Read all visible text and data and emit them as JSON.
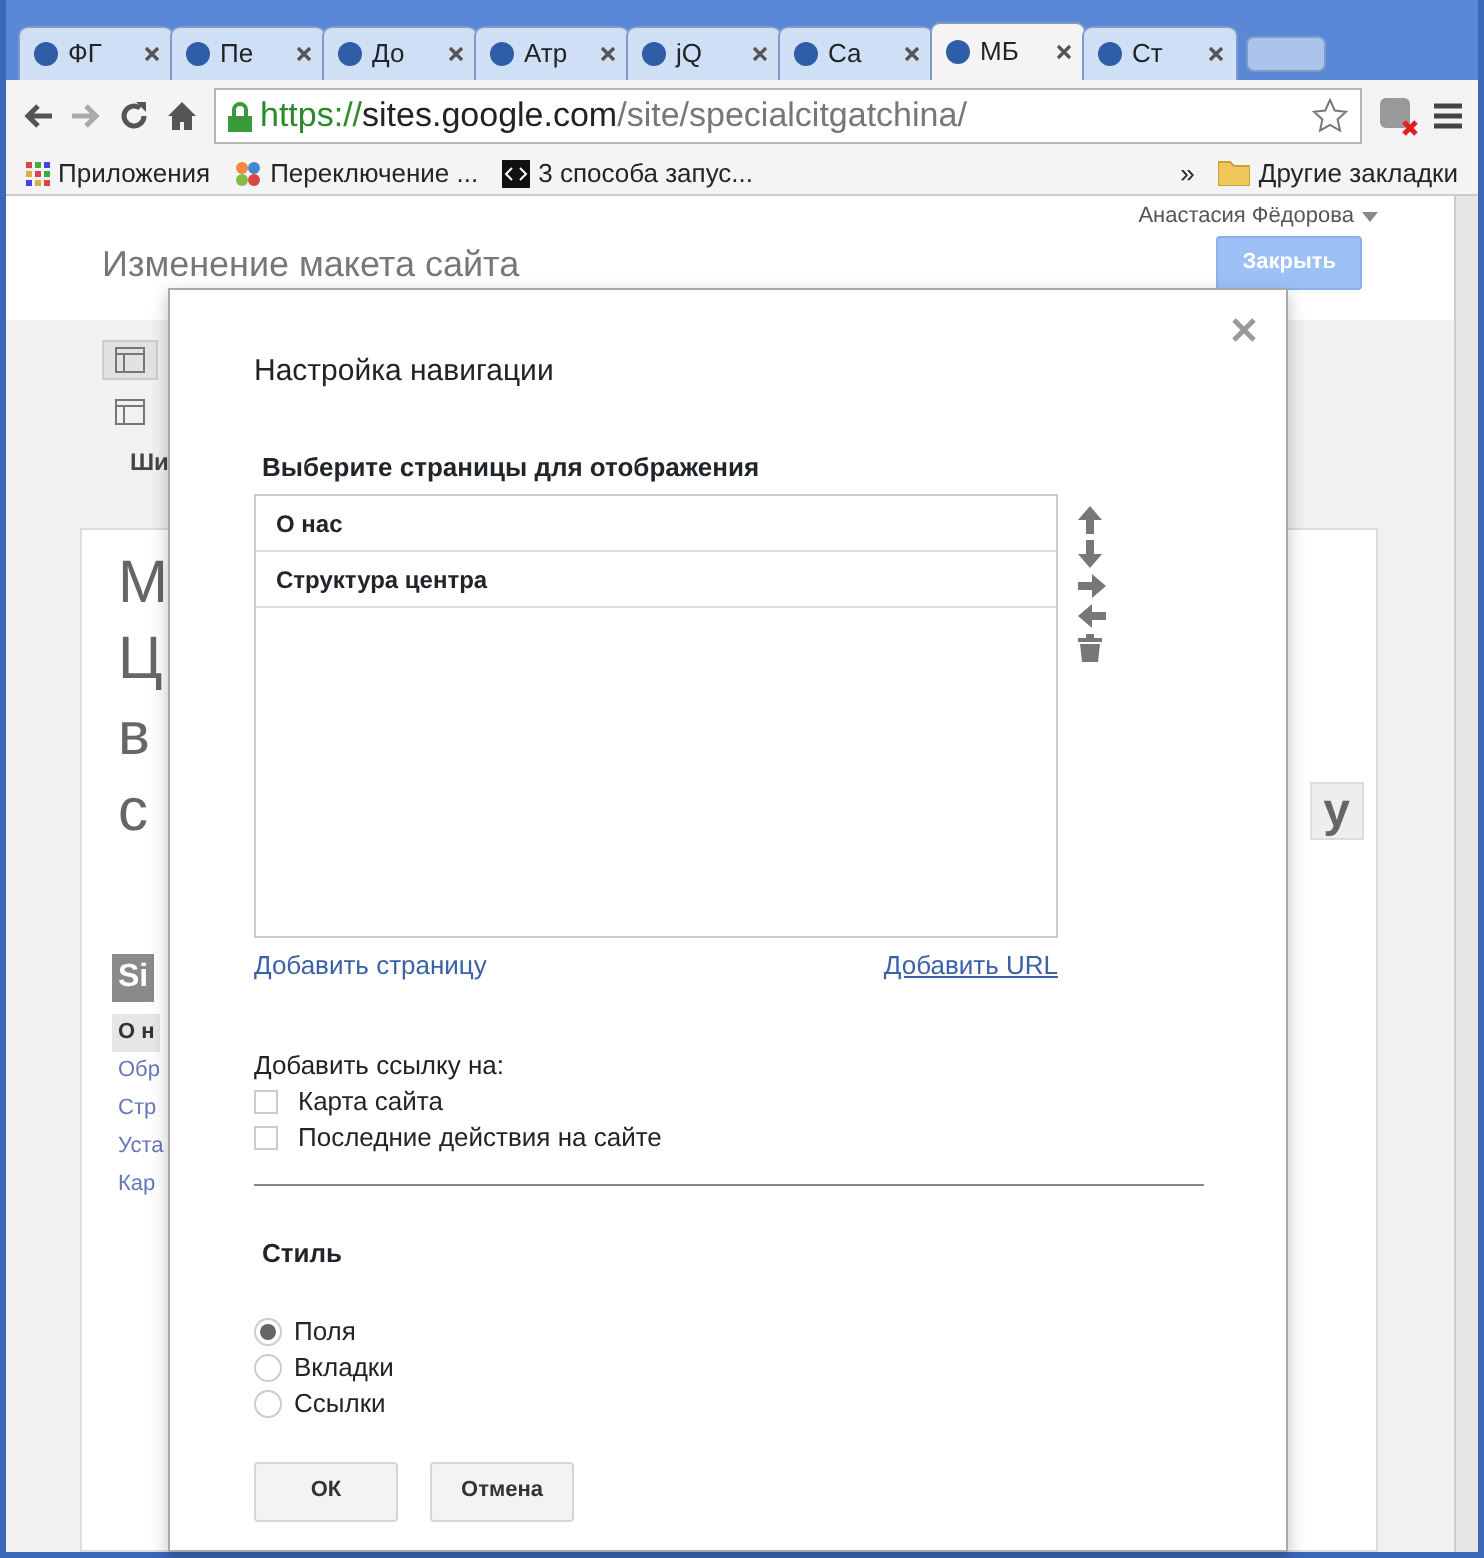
{
  "browser": {
    "tabs": [
      {
        "label": "ФГ",
        "selected": false
      },
      {
        "label": "Пе",
        "selected": false
      },
      {
        "label": "До",
        "selected": false
      },
      {
        "label": "Атр",
        "selected": false
      },
      {
        "label": "jQ",
        "selected": false
      },
      {
        "label": "Са",
        "selected": false
      },
      {
        "label": "МБ",
        "selected": true
      },
      {
        "label": "Ст",
        "selected": false
      }
    ],
    "url": {
      "scheme": "https://",
      "host": "sites.google.com",
      "path": "/site/specialcitgatchina/"
    },
    "bookmarks": [
      "Приложения",
      "Переключение ...",
      "3 способа запус..."
    ],
    "overflow": "»",
    "other_bookmarks": "Другие закладки"
  },
  "page": {
    "user": "Анастасия Фёдорова",
    "title": "Изменение макета сайта",
    "close_button": "Закрыть",
    "layout_label": "Ши",
    "big_letters": [
      "М",
      "Ц",
      "в",
      "с"
    ],
    "right_fragment": "у",
    "sidebar_title": "Si",
    "sidebar_items": [
      {
        "label": "О н",
        "selected": true
      },
      {
        "label": "Обр",
        "selected": false
      },
      {
        "label": "Стр",
        "selected": false
      },
      {
        "label": "Уста",
        "selected": false
      },
      {
        "label": "Кар",
        "selected": false
      }
    ]
  },
  "dialog": {
    "title": "Настройка навигации",
    "pages_label": "Выберите страницы для отображения",
    "pages": [
      {
        "label": "О нас"
      },
      {
        "label": "Структура центра"
      }
    ],
    "add_page": "Добавить страницу",
    "add_url": "Добавить URL",
    "add_link_label": "Добавить ссылку на:",
    "link_options": [
      {
        "label": "Карта сайта",
        "checked": false
      },
      {
        "label": "Последние действия на сайте",
        "checked": false
      }
    ],
    "style_label": "Стиль",
    "styles": [
      {
        "label": "Поля",
        "selected": true
      },
      {
        "label": "Вкладки",
        "selected": false
      },
      {
        "label": "Ссылки",
        "selected": false
      }
    ],
    "buttons": [
      "ОК",
      "Отмена"
    ]
  }
}
